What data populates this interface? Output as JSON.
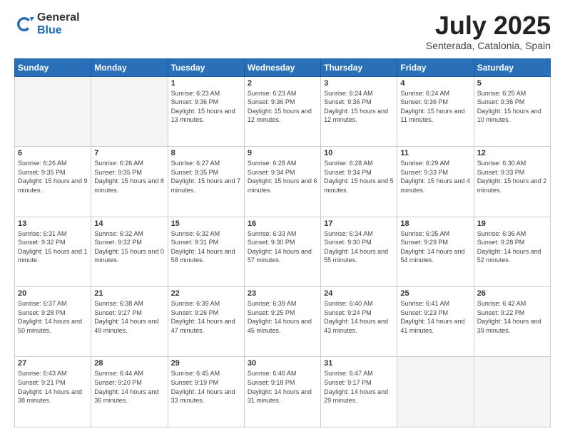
{
  "header": {
    "logo_general": "General",
    "logo_blue": "Blue",
    "month_title": "July 2025",
    "location": "Senterada, Catalonia, Spain"
  },
  "days_of_week": [
    "Sunday",
    "Monday",
    "Tuesday",
    "Wednesday",
    "Thursday",
    "Friday",
    "Saturday"
  ],
  "weeks": [
    [
      {
        "day": "",
        "info": ""
      },
      {
        "day": "",
        "info": ""
      },
      {
        "day": "1",
        "info": "Sunrise: 6:23 AM\nSunset: 9:36 PM\nDaylight: 15 hours and 13 minutes."
      },
      {
        "day": "2",
        "info": "Sunrise: 6:23 AM\nSunset: 9:36 PM\nDaylight: 15 hours and 12 minutes."
      },
      {
        "day": "3",
        "info": "Sunrise: 6:24 AM\nSunset: 9:36 PM\nDaylight: 15 hours and 12 minutes."
      },
      {
        "day": "4",
        "info": "Sunrise: 6:24 AM\nSunset: 9:36 PM\nDaylight: 15 hours and 11 minutes."
      },
      {
        "day": "5",
        "info": "Sunrise: 6:25 AM\nSunset: 9:36 PM\nDaylight: 15 hours and 10 minutes."
      }
    ],
    [
      {
        "day": "6",
        "info": "Sunrise: 6:26 AM\nSunset: 9:35 PM\nDaylight: 15 hours and 9 minutes."
      },
      {
        "day": "7",
        "info": "Sunrise: 6:26 AM\nSunset: 9:35 PM\nDaylight: 15 hours and 8 minutes."
      },
      {
        "day": "8",
        "info": "Sunrise: 6:27 AM\nSunset: 9:35 PM\nDaylight: 15 hours and 7 minutes."
      },
      {
        "day": "9",
        "info": "Sunrise: 6:28 AM\nSunset: 9:34 PM\nDaylight: 15 hours and 6 minutes."
      },
      {
        "day": "10",
        "info": "Sunrise: 6:28 AM\nSunset: 9:34 PM\nDaylight: 15 hours and 5 minutes."
      },
      {
        "day": "11",
        "info": "Sunrise: 6:29 AM\nSunset: 9:33 PM\nDaylight: 15 hours and 4 minutes."
      },
      {
        "day": "12",
        "info": "Sunrise: 6:30 AM\nSunset: 9:33 PM\nDaylight: 15 hours and 2 minutes."
      }
    ],
    [
      {
        "day": "13",
        "info": "Sunrise: 6:31 AM\nSunset: 9:32 PM\nDaylight: 15 hours and 1 minute."
      },
      {
        "day": "14",
        "info": "Sunrise: 6:32 AM\nSunset: 9:32 PM\nDaylight: 15 hours and 0 minutes."
      },
      {
        "day": "15",
        "info": "Sunrise: 6:32 AM\nSunset: 9:31 PM\nDaylight: 14 hours and 58 minutes."
      },
      {
        "day": "16",
        "info": "Sunrise: 6:33 AM\nSunset: 9:30 PM\nDaylight: 14 hours and 57 minutes."
      },
      {
        "day": "17",
        "info": "Sunrise: 6:34 AM\nSunset: 9:30 PM\nDaylight: 14 hours and 55 minutes."
      },
      {
        "day": "18",
        "info": "Sunrise: 6:35 AM\nSunset: 9:29 PM\nDaylight: 14 hours and 54 minutes."
      },
      {
        "day": "19",
        "info": "Sunrise: 6:36 AM\nSunset: 9:28 PM\nDaylight: 14 hours and 52 minutes."
      }
    ],
    [
      {
        "day": "20",
        "info": "Sunrise: 6:37 AM\nSunset: 9:28 PM\nDaylight: 14 hours and 50 minutes."
      },
      {
        "day": "21",
        "info": "Sunrise: 6:38 AM\nSunset: 9:27 PM\nDaylight: 14 hours and 49 minutes."
      },
      {
        "day": "22",
        "info": "Sunrise: 6:39 AM\nSunset: 9:26 PM\nDaylight: 14 hours and 47 minutes."
      },
      {
        "day": "23",
        "info": "Sunrise: 6:39 AM\nSunset: 9:25 PM\nDaylight: 14 hours and 45 minutes."
      },
      {
        "day": "24",
        "info": "Sunrise: 6:40 AM\nSunset: 9:24 PM\nDaylight: 14 hours and 43 minutes."
      },
      {
        "day": "25",
        "info": "Sunrise: 6:41 AM\nSunset: 9:23 PM\nDaylight: 14 hours and 41 minutes."
      },
      {
        "day": "26",
        "info": "Sunrise: 6:42 AM\nSunset: 9:22 PM\nDaylight: 14 hours and 39 minutes."
      }
    ],
    [
      {
        "day": "27",
        "info": "Sunrise: 6:43 AM\nSunset: 9:21 PM\nDaylight: 14 hours and 38 minutes."
      },
      {
        "day": "28",
        "info": "Sunrise: 6:44 AM\nSunset: 9:20 PM\nDaylight: 14 hours and 36 minutes."
      },
      {
        "day": "29",
        "info": "Sunrise: 6:45 AM\nSunset: 9:19 PM\nDaylight: 14 hours and 33 minutes."
      },
      {
        "day": "30",
        "info": "Sunrise: 6:46 AM\nSunset: 9:18 PM\nDaylight: 14 hours and 31 minutes."
      },
      {
        "day": "31",
        "info": "Sunrise: 6:47 AM\nSunset: 9:17 PM\nDaylight: 14 hours and 29 minutes."
      },
      {
        "day": "",
        "info": ""
      },
      {
        "day": "",
        "info": ""
      }
    ]
  ]
}
